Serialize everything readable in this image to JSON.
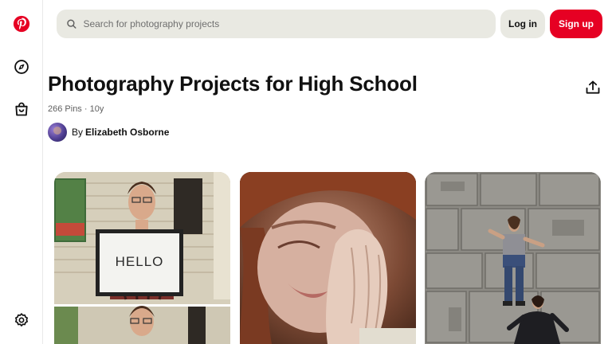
{
  "header": {
    "search_placeholder": "Search for photography projects",
    "login_label": "Log in",
    "signup_label": "Sign up"
  },
  "sidebar": {
    "items": [
      {
        "icon": "pinterest-logo-icon"
      },
      {
        "icon": "explore-icon"
      },
      {
        "icon": "shop-icon"
      },
      {
        "icon": "settings-icon"
      }
    ]
  },
  "board": {
    "title": "Photography Projects for High School",
    "meta": "266 Pins · 10y",
    "by_label": "By",
    "author": "Elizabeth Osborne"
  },
  "pins": [
    {
      "image": "hello-sign-photo"
    },
    {
      "image": "hand-pressed-face-photo"
    },
    {
      "image": "lying-on-stone-floor-photo"
    }
  ],
  "colors": {
    "brand_red": "#e60023",
    "search_bg": "#e9e9e2"
  }
}
